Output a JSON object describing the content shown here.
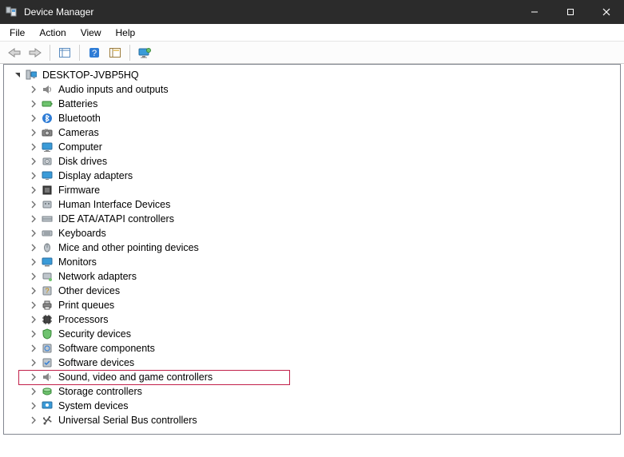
{
  "title": "Device Manager",
  "window_controls": {
    "minimize": "—",
    "maximize": "▢",
    "close": "✕"
  },
  "menu": [
    "File",
    "Action",
    "View",
    "Help"
  ],
  "toolbar": {
    "back": "back-arrow",
    "forward": "forward-arrow",
    "show_hidden": "show-hidden",
    "help": "help",
    "action": "action-properties",
    "scan": "scan-monitor"
  },
  "tree": {
    "root": {
      "label": "DESKTOP-JVBP5HQ",
      "expanded": true
    },
    "categories": [
      {
        "label": "Audio inputs and outputs",
        "icon": "audio",
        "highlighted": false
      },
      {
        "label": "Batteries",
        "icon": "battery",
        "highlighted": false
      },
      {
        "label": "Bluetooth",
        "icon": "bluetooth",
        "highlighted": false
      },
      {
        "label": "Cameras",
        "icon": "camera",
        "highlighted": false
      },
      {
        "label": "Computer",
        "icon": "computer",
        "highlighted": false
      },
      {
        "label": "Disk drives",
        "icon": "disk",
        "highlighted": false
      },
      {
        "label": "Display adapters",
        "icon": "display",
        "highlighted": false
      },
      {
        "label": "Firmware",
        "icon": "firmware",
        "highlighted": false
      },
      {
        "label": "Human Interface Devices",
        "icon": "hid",
        "highlighted": false
      },
      {
        "label": "IDE ATA/ATAPI controllers",
        "icon": "ide",
        "highlighted": false
      },
      {
        "label": "Keyboards",
        "icon": "keyboard",
        "highlighted": false
      },
      {
        "label": "Mice and other pointing devices",
        "icon": "mouse",
        "highlighted": false
      },
      {
        "label": "Monitors",
        "icon": "monitor",
        "highlighted": false
      },
      {
        "label": "Network adapters",
        "icon": "network",
        "highlighted": false
      },
      {
        "label": "Other devices",
        "icon": "other",
        "highlighted": false
      },
      {
        "label": "Print queues",
        "icon": "printer",
        "highlighted": false
      },
      {
        "label": "Processors",
        "icon": "cpu",
        "highlighted": false
      },
      {
        "label": "Security devices",
        "icon": "security",
        "highlighted": false
      },
      {
        "label": "Software components",
        "icon": "swcomp",
        "highlighted": false
      },
      {
        "label": "Software devices",
        "icon": "swdev",
        "highlighted": false
      },
      {
        "label": "Sound, video and game controllers",
        "icon": "sound",
        "highlighted": true
      },
      {
        "label": "Storage controllers",
        "icon": "storage",
        "highlighted": false
      },
      {
        "label": "System devices",
        "icon": "system",
        "highlighted": false
      },
      {
        "label": "Universal Serial Bus controllers",
        "icon": "usb",
        "highlighted": false
      }
    ]
  },
  "colors": {
    "titlebar_bg": "#2b2b2b",
    "highlight_border": "#c1204a",
    "content_border": "#828790"
  }
}
